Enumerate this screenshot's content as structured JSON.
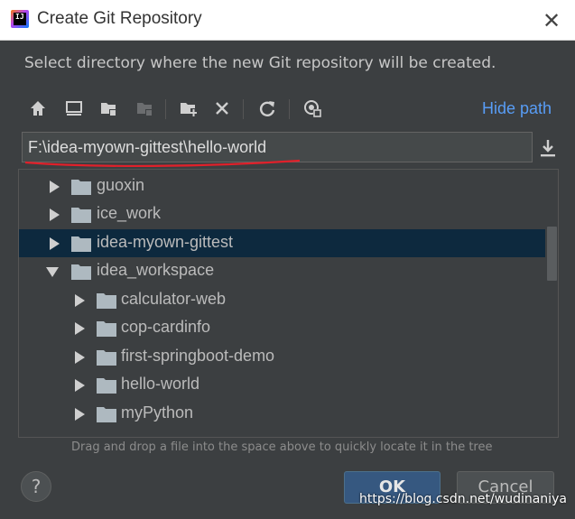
{
  "window": {
    "title": "Create Git Repository",
    "app_icon_text": "IJ"
  },
  "description": "Select directory where the new Git repository will be created.",
  "toolbar": {
    "buttons": [
      "home-icon",
      "desktop-icon",
      "project-folder-icon",
      "module-folder-icon",
      "new-folder-icon",
      "delete-icon",
      "refresh-icon",
      "show-hidden-icon"
    ],
    "hide_path_label": "Hide path"
  },
  "path_input": {
    "value": "F:\\idea-myown-gittest\\hello-world"
  },
  "tree": {
    "rows": [
      {
        "label": "guoxin",
        "expanded": false,
        "selected": false,
        "depth": 0
      },
      {
        "label": "ice_work",
        "expanded": false,
        "selected": false,
        "depth": 0
      },
      {
        "label": "idea-myown-gittest",
        "expanded": false,
        "selected": true,
        "depth": 0
      },
      {
        "label": "idea_workspace",
        "expanded": true,
        "selected": false,
        "depth": 0
      },
      {
        "label": "calculator-web",
        "expanded": false,
        "selected": false,
        "depth": 1
      },
      {
        "label": "cop-cardinfo",
        "expanded": false,
        "selected": false,
        "depth": 1
      },
      {
        "label": "first-springboot-demo",
        "expanded": false,
        "selected": false,
        "depth": 1
      },
      {
        "label": "hello-world",
        "expanded": false,
        "selected": false,
        "depth": 1
      },
      {
        "label": "myPython",
        "expanded": false,
        "selected": false,
        "depth": 1
      }
    ]
  },
  "hint": "Drag and drop a file into the space above to quickly locate it in the tree",
  "buttons": {
    "help": "?",
    "ok": "OK",
    "cancel": "Cancel"
  },
  "watermark": "https://blog.csdn.net/wudinaniya",
  "colors": {
    "accent": "#589df6",
    "selection": "#0d293e",
    "ok_button": "#365880",
    "background": "#3c3f41",
    "underline": "#e0202a"
  }
}
